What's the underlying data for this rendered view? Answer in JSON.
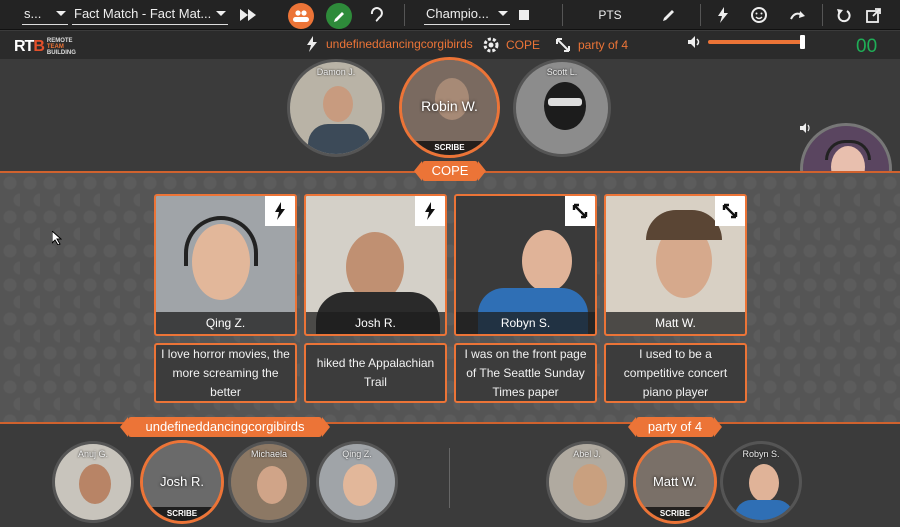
{
  "toolbar": {
    "mode_select": "s...",
    "game_select": "Fact Match - Fact Mat...",
    "board_select": "Champio...",
    "pts_label": "PTS"
  },
  "status": {
    "team_name": "undefineddancingcorgibirds",
    "category": "COPE",
    "party": "party of 4",
    "score": "00",
    "volume_percent": 97
  },
  "logo": {
    "mark": "RTB",
    "text_lines": [
      "REMOTE",
      "TEAM",
      "BUILDING"
    ]
  },
  "top_players": [
    {
      "name": "Damon J.",
      "active": false,
      "scribe": false
    },
    {
      "name": "Robin W.",
      "active": true,
      "scribe": true
    },
    {
      "name": "Scott L.",
      "active": false,
      "scribe": false
    }
  ],
  "scribe_label": "SCRIBE",
  "board": {
    "category_label": "COPE",
    "cards": [
      {
        "name": "Qing Z.",
        "icon": "lightning-icon",
        "fact": "I love horror movies, the more screaming the better"
      },
      {
        "name": "Josh R.",
        "icon": "lightning-icon",
        "fact": "hiked the Appalachian Trail"
      },
      {
        "name": "Robyn S.",
        "icon": "swap-arrows-icon",
        "fact": "I was on the front page of The Seattle Sunday Times paper"
      },
      {
        "name": "Matt W.",
        "icon": "swap-arrows-icon",
        "fact": "I used to be a competitive concert piano player"
      }
    ]
  },
  "teams": [
    {
      "label": "undefineddancingcorgibirds",
      "members": [
        {
          "name": "Anuj G.",
          "active": false,
          "scribe": false
        },
        {
          "name": "Josh R.",
          "active": true,
          "scribe": true
        },
        {
          "name": "Michaela",
          "active": false,
          "scribe": false
        },
        {
          "name": "Qing Z.",
          "active": false,
          "scribe": false
        }
      ]
    },
    {
      "label": "party of 4",
      "members": [
        {
          "name": "Abel J.",
          "active": false,
          "scribe": false
        },
        {
          "name": "Matt W.",
          "active": true,
          "scribe": true
        },
        {
          "name": "Robyn S.",
          "active": false,
          "scribe": false
        }
      ]
    }
  ],
  "colors": {
    "accent": "#ec7437",
    "score_green": "#1fae57",
    "people_button": "#ec7437",
    "pencil_button": "#2e8b3a"
  }
}
